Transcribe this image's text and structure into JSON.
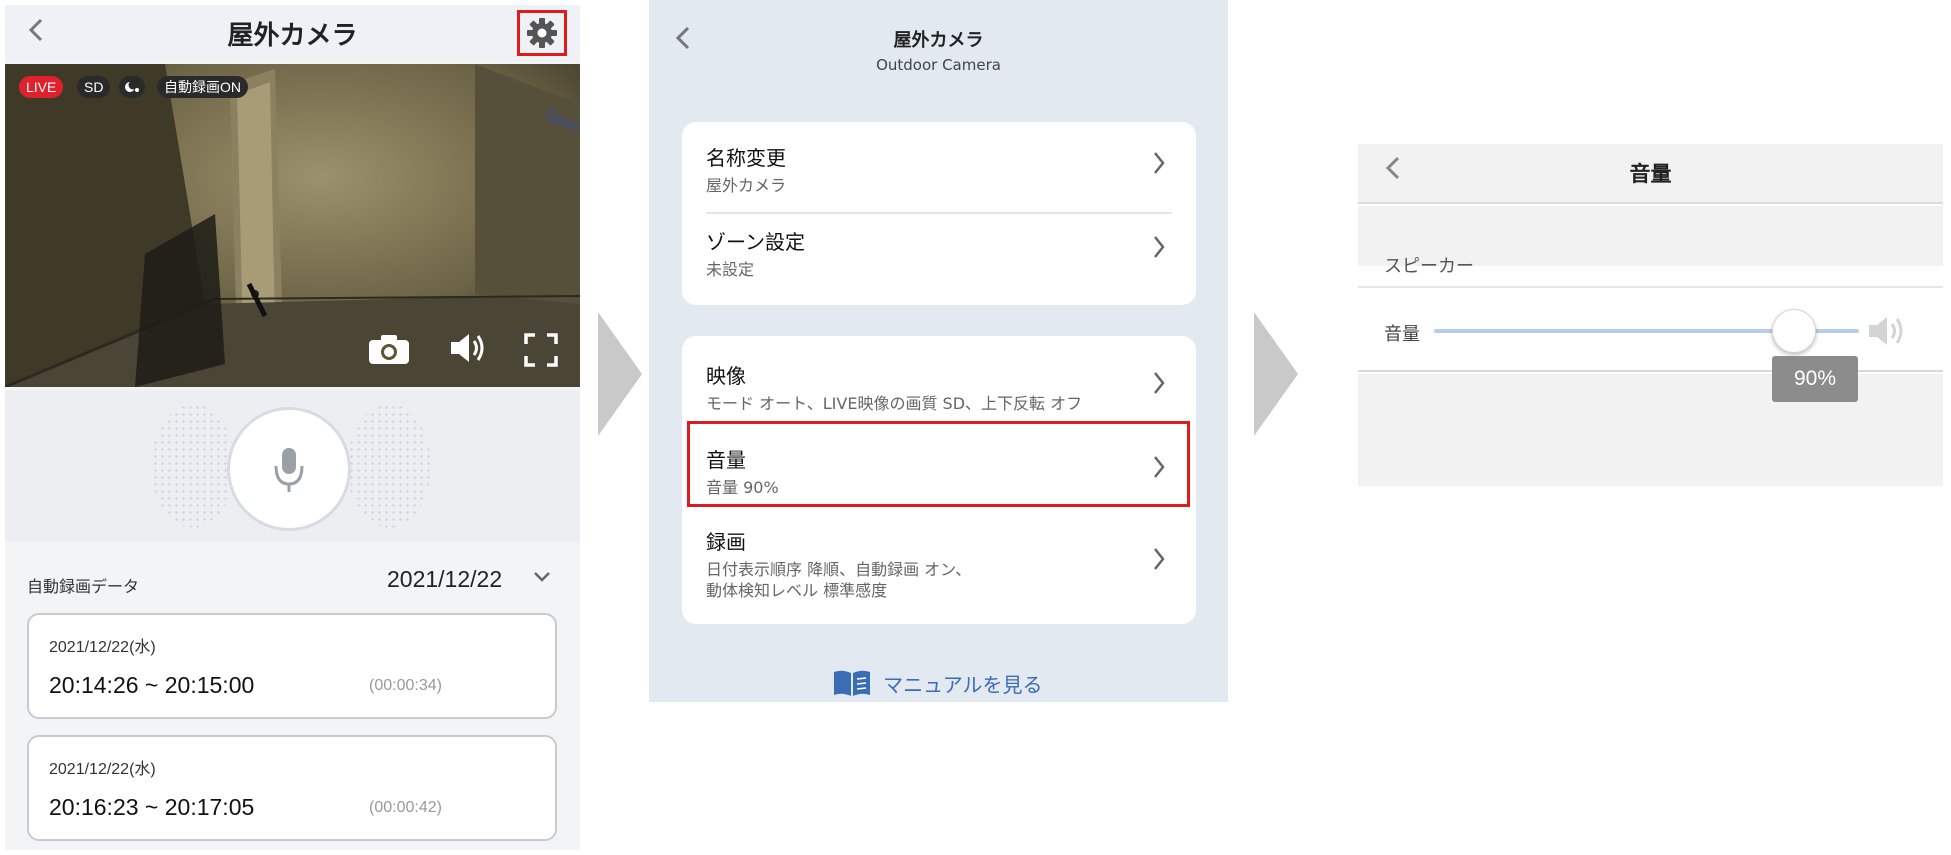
{
  "panel1": {
    "title": "屋外カメラ",
    "back_label": "<",
    "badges": {
      "live": "LIVE",
      "sd": "SD",
      "auto_record": "自動録画ON"
    },
    "record_section_label": "自動録画データ",
    "selected_date": "2021/12/22",
    "recordings": [
      {
        "date": "2021/12/22(水)",
        "time_range": "20:14:26 ~ 20:15:00",
        "duration": "(00:00:34)"
      },
      {
        "date": "2021/12/22(水)",
        "time_range": "20:16:23 ~ 20:17:05",
        "duration": "(00:00:42)"
      }
    ],
    "wall_text": "Space",
    "highlight_color": "#e01b1b"
  },
  "panel2": {
    "title": "屋外カメラ",
    "subtitle": "Outdoor Camera",
    "group1": [
      {
        "label": "名称変更",
        "value": "屋外カメラ"
      },
      {
        "label": "ゾーン設定",
        "value": "未設定"
      }
    ],
    "group2": [
      {
        "label": "映像",
        "value": "モード オート、LIVE映像の画質 SD、上下反転 オフ"
      },
      {
        "label": "音量",
        "value": "音量 90%"
      },
      {
        "label": "録画",
        "value": "日付表示順序 降順、自動録画 オン、",
        "value2": "動体検知レベル 標準感度"
      }
    ],
    "manual_link": "マニュアルを見る",
    "accent_color": "#3b6db5"
  },
  "panel3": {
    "title": "音量",
    "section_label": "スピーカー",
    "volume_label": "音量",
    "volume_value": "90%",
    "volume_fraction": 0.9
  }
}
